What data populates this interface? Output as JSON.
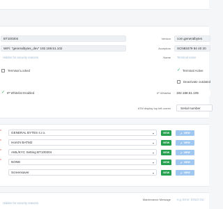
{
  "top": {
    "terminal_name_value": "BT100304",
    "wifi_value": "WiFi: \"generalbytes_dev\" 192.168.51.102",
    "security_hint": "Hidden for security reasons",
    "version_label": "Version",
    "version_value": "com.generalbytes",
    "acceptors_label": "Acceptors",
    "acceptors_value": "SCN83479 84 40 20",
    "name_label": "Name",
    "name_placeholder": "Terminal name",
    "terminal_locked_label": "Terminal Locked",
    "terminal_active_label": "Terminal Active",
    "deactivate_label": "Deactivate outdated",
    "ip_whitelist_enabled_label": "IP Whitelist Enabled",
    "ip_whitelist_label": "IP Whitelist",
    "ip_whitelist_value": "192.168.51.105",
    "display_corner_label": "ATM display top left corner",
    "display_corner_value": "Serial number"
  },
  "assignments": {
    "rows": [
      {
        "value": "GENERAL BYTES s.r.o.",
        "view": "VIEW",
        "view2": "VIEW"
      },
      {
        "value": "Horst's BATM2",
        "view": "VIEW",
        "view2": "VIEW"
      },
      {
        "value": "AML/KYC Setting BT100304",
        "view": "VIEW",
        "view2": "VIEW"
      },
      {
        "value": "NONE",
        "view": "VIEW",
        "view2": "VIEW"
      },
      {
        "value": "Screensaver",
        "view": "VIEW",
        "view2": "VIEW"
      }
    ]
  },
  "bottom": {
    "security_hint": "Hidden for security reasons",
    "maintenance_label": "Maintenance Message",
    "maintenance_placeholder": "e.g. Error: SOLD OU"
  },
  "icons": {
    "caret": "chevron-down-icon",
    "tick": "check-icon",
    "external": "external-link-icon"
  },
  "colors": {
    "view_green": "#24a04e",
    "view_blue": "#9fc7ef",
    "active_green": "#2fb36b",
    "hint_blue": "#9fb9d0"
  }
}
